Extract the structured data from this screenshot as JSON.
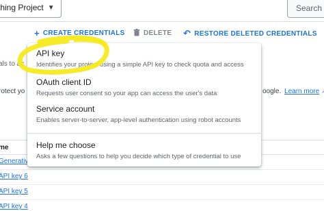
{
  "header": {
    "project_label": "thing Project",
    "search_placeholder": "Search"
  },
  "toolbar": {
    "page_heading": "s",
    "create_label": "CREATE CREDENTIALS",
    "delete_label": "DELETE",
    "restore_label": "RESTORE DELETED CREDENTIALS"
  },
  "background": {
    "helper_line_1": "als to ac",
    "helper_line_2": "rotect yo",
    "right_note_text": "oogle.",
    "right_note_link": "Learn more",
    "table_header_name": "me",
    "rows": [
      {
        "name": "Generativ"
      },
      {
        "name": "API key 6"
      },
      {
        "name": "API key 5"
      },
      {
        "name": "API key 4"
      }
    ]
  },
  "menu": {
    "items": [
      {
        "title": "API key",
        "desc": "Identifies your project using a simple API key to check quota and access"
      },
      {
        "title": "OAuth client ID",
        "desc": "Requests user consent so your app can access the user's data"
      },
      {
        "title": "Service account",
        "desc": "Enables server-to-server, app-level authentication using robot accounts"
      },
      {
        "title": "Help me choose",
        "desc": "Asks a few questions to help you decide which type of credential to use"
      }
    ]
  },
  "colors": {
    "accent": "#1a73e8",
    "highlight": "#f5ea1c"
  }
}
